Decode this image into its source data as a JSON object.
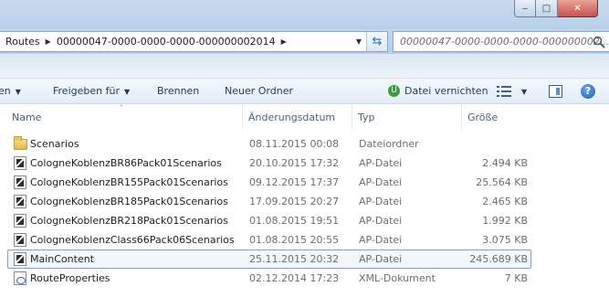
{
  "window": {
    "minimize_glyph": "‒",
    "maximize_glyph": "□",
    "close_glyph": "✕"
  },
  "address": {
    "crumbs": [
      "Routes",
      "00000047-0000-0000-0000-000000002014"
    ],
    "separator": "▶",
    "dropdown_glyph": "▼",
    "refresh_glyph": "⇆"
  },
  "search": {
    "placeholder": "00000047-0000-0000-0000-000000002..."
  },
  "toolbar": {
    "items": [
      {
        "label": "en",
        "has_arrow": true
      },
      {
        "label": "Freigeben für",
        "has_arrow": true
      },
      {
        "label": "Brennen",
        "has_arrow": false
      },
      {
        "label": "Neuer Ordner",
        "has_arrow": false
      },
      {
        "label": "Datei vernichten",
        "has_arrow": false
      }
    ],
    "arrow_glyph": "▼",
    "help_glyph": "?",
    "shred_glyph": "U"
  },
  "columns": {
    "name": "Name",
    "date": "Änderungsdatum",
    "type": "Typ",
    "size": "Größe",
    "sort_glyph": "˄"
  },
  "files": [
    {
      "icon": "folder-icon",
      "name": "Scenarios",
      "date": "08.11.2015 00:08",
      "type": "Dateiordner",
      "size": ""
    },
    {
      "icon": "ap-file-icon",
      "name": "CologneKoblenzBR86Pack01Scenarios",
      "date": "20.10.2015 17:32",
      "type": "AP-Datei",
      "size": "2.494 KB"
    },
    {
      "icon": "ap-file-icon",
      "name": "CologneKoblenzBR155Pack01Scenarios",
      "date": "09.12.2015 17:37",
      "type": "AP-Datei",
      "size": "25.564 KB"
    },
    {
      "icon": "ap-file-icon",
      "name": "CologneKoblenzBR185Pack01Scenarios",
      "date": "17.09.2015 20:27",
      "type": "AP-Datei",
      "size": "2.465 KB"
    },
    {
      "icon": "ap-file-icon",
      "name": "CologneKoblenzBR218Pack01Scenarios",
      "date": "01.08.2015 19:51",
      "type": "AP-Datei",
      "size": "1.992 KB"
    },
    {
      "icon": "ap-file-icon",
      "name": "CologneKoblenzClass66Pack06Scenarios",
      "date": "01.08.2015 20:55",
      "type": "AP-Datei",
      "size": "3.075 KB"
    },
    {
      "icon": "ap-file-icon",
      "name": "MainContent",
      "date": "25.11.2015 20:32",
      "type": "AP-Datei",
      "size": "245.689 KB",
      "selected": true
    },
    {
      "icon": "xml-file-icon",
      "name": "RouteProperties",
      "date": "02.12.2014 17:23",
      "type": "XML-Dokument",
      "size": "7 KB"
    }
  ]
}
